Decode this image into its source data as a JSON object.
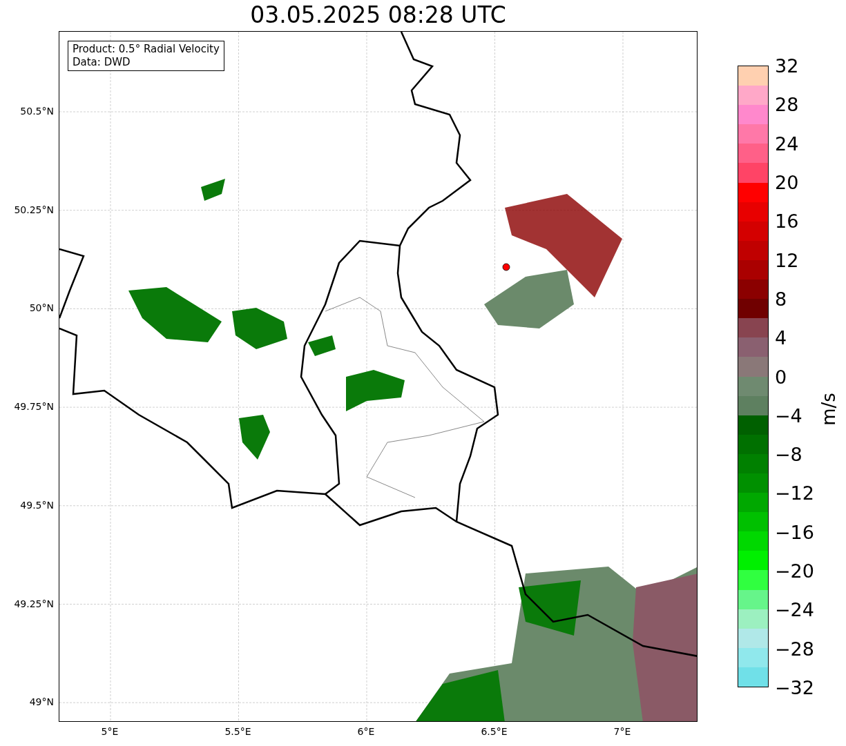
{
  "title": "03.05.2025 08:28 UTC",
  "legend": [
    "Product: 0.5° Radial Velocity",
    "Data: DWD"
  ],
  "map": {
    "y_ticks": [
      "50.5°N",
      "50.25°N",
      "50°N",
      "49.75°N",
      "49.5°N",
      "49.25°N",
      "49°N"
    ],
    "x_ticks": [
      "5°E",
      "5.5°E",
      "6°E",
      "6.5°E",
      "7°E"
    ]
  },
  "colorbar": {
    "label": "m/s",
    "ticks": [
      "32",
      "28",
      "24",
      "20",
      "16",
      "12",
      "8",
      "4",
      "0",
      "−4",
      "−8",
      "−12",
      "−16",
      "−20",
      "−24",
      "−28",
      "−32"
    ],
    "bands": [
      {
        "color": "#ffd0b0"
      },
      {
        "color": "#ffa8c8"
      },
      {
        "color": "#ff88cc"
      },
      {
        "color": "#ff78a8"
      },
      {
        "color": "#ff6088"
      },
      {
        "color": "#ff4466"
      },
      {
        "color": "#ff0000"
      },
      {
        "color": "#e80000"
      },
      {
        "color": "#d40000"
      },
      {
        "color": "#c00000"
      },
      {
        "color": "#aa0000"
      },
      {
        "color": "#8b0000"
      },
      {
        "color": "#700000"
      },
      {
        "color": "#884450"
      },
      {
        "color": "#8a6070"
      },
      {
        "color": "#8a7878"
      },
      {
        "color": "#6f8a70"
      },
      {
        "color": "#5e8060"
      },
      {
        "color": "#006000"
      },
      {
        "color": "#007000"
      },
      {
        "color": "#008000"
      },
      {
        "color": "#009000"
      },
      {
        "color": "#00a800"
      },
      {
        "color": "#00c000"
      },
      {
        "color": "#00d800"
      },
      {
        "color": "#00f000"
      },
      {
        "color": "#30ff40"
      },
      {
        "color": "#66f58a"
      },
      {
        "color": "#9cf0c0"
      },
      {
        "color": "#b0e8e8"
      },
      {
        "color": "#90e8ec"
      },
      {
        "color": "#70e0e8"
      }
    ]
  }
}
